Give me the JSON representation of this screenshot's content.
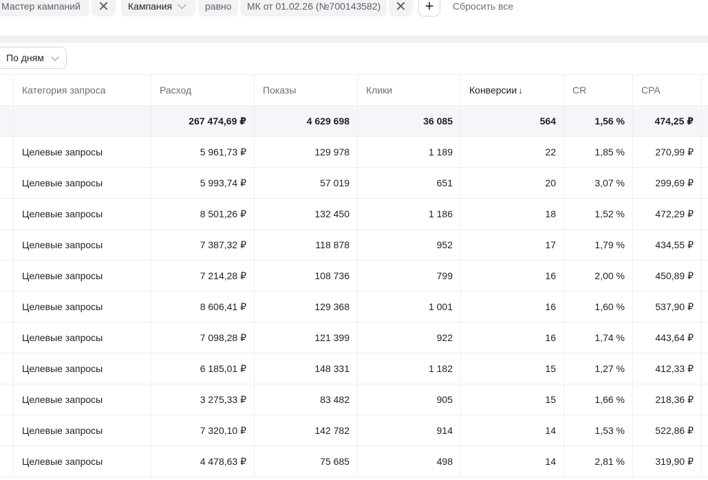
{
  "filters": {
    "chip1": "Мастер кампаний",
    "chip2": "Кампания",
    "chip3": "равно",
    "chip4": "МК от 01.02.26 (№700143582)",
    "close_glyph": "✕",
    "add_glyph": "+",
    "reset_label": "Сбросить все"
  },
  "grouping": {
    "selected": "По дням"
  },
  "table": {
    "headers": [
      "Категория запроса",
      "Расход",
      "Показы",
      "Клики",
      "Конверсии",
      "CR",
      "CPA"
    ],
    "sort_arrow": "↓",
    "total": [
      "",
      "267 474,69 ₽",
      "4 629 698",
      "36 085",
      "564",
      "1,56 %",
      "474,25 ₽"
    ],
    "rows": [
      [
        "Целевые запросы",
        "5 961,73 ₽",
        "129 978",
        "1 189",
        "22",
        "1,85 %",
        "270,99 ₽"
      ],
      [
        "Целевые запросы",
        "5 993,74 ₽",
        "57 019",
        "651",
        "20",
        "3,07 %",
        "299,69 ₽"
      ],
      [
        "Целевые запросы",
        "8 501,26 ₽",
        "132 450",
        "1 186",
        "18",
        "1,52 %",
        "472,29 ₽"
      ],
      [
        "Целевые запросы",
        "7 387,32 ₽",
        "118 878",
        "952",
        "17",
        "1,79 %",
        "434,55 ₽"
      ],
      [
        "Целевые запросы",
        "7 214,28 ₽",
        "108 736",
        "799",
        "16",
        "2,00 %",
        "450,89 ₽"
      ],
      [
        "Целевые запросы",
        "8 606,41 ₽",
        "129 368",
        "1 001",
        "16",
        "1,60 %",
        "537,90 ₽"
      ],
      [
        "Целевые запросы",
        "7 098,28 ₽",
        "121 399",
        "922",
        "16",
        "1,74 %",
        "443,64 ₽"
      ],
      [
        "Целевые запросы",
        "6 185,01 ₽",
        "148 331",
        "1 182",
        "15",
        "1,27 %",
        "412,33 ₽"
      ],
      [
        "Целевые запросы",
        "3 275,33 ₽",
        "83 482",
        "905",
        "15",
        "1,66 %",
        "218,36 ₽"
      ],
      [
        "Целевые запросы",
        "7 320,10 ₽",
        "142 782",
        "914",
        "14",
        "1,53 %",
        "522,86 ₽"
      ],
      [
        "Целевые запросы",
        "4 478,63 ₽",
        "75 685",
        "498",
        "14",
        "2,81 %",
        "319,90 ₽"
      ]
    ]
  }
}
